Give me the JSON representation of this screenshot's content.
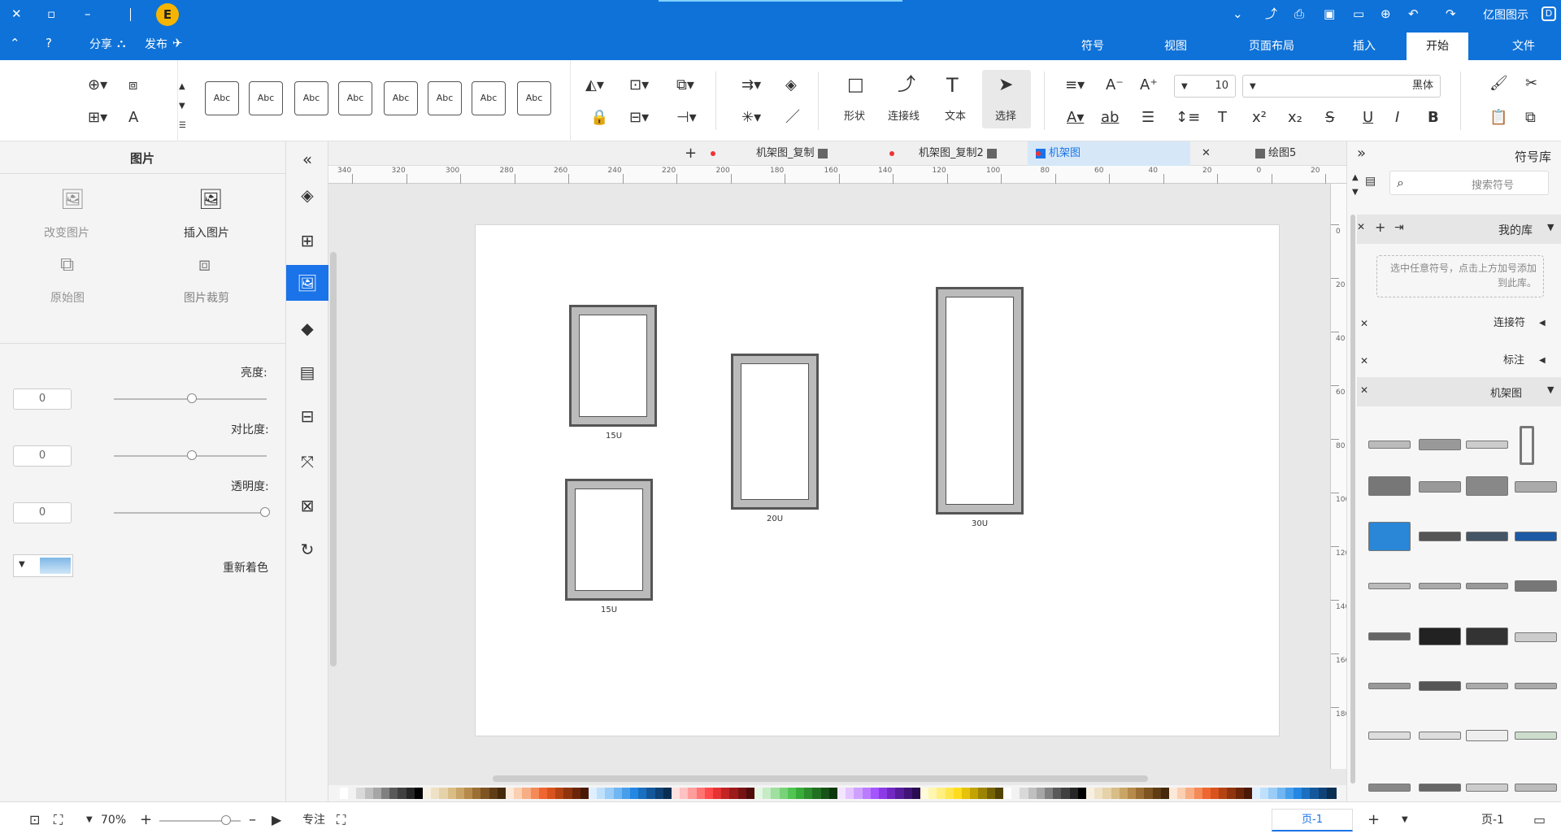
{
  "title_bar": {
    "app_name": "亿图图示",
    "publish_label": "发布",
    "share_label": "分享",
    "tabs": [
      "文件",
      "开始",
      "插入",
      "页面布局",
      "视图",
      "符号"
    ],
    "active_tab": "开始"
  },
  "ribbon": {
    "font_name": "黑体",
    "font_size": "10",
    "select_label": "选择",
    "text_label": "文本",
    "connector_label": "连接线",
    "shape_label": "形状",
    "style_sample": "Abc"
  },
  "doc_tabs": {
    "items": [
      "绘图5",
      "机架图",
      "机架图_复制2",
      "机架图_复制"
    ],
    "active": "机架图"
  },
  "ruler": {
    "h_ticks": [
      "20",
      "0",
      "20",
      "40",
      "60",
      "80",
      "100",
      "120",
      "140",
      "160",
      "180",
      "200",
      "220",
      "240",
      "260",
      "280",
      "300",
      "320",
      "340"
    ],
    "v_ticks": [
      "0",
      "20",
      "40",
      "60",
      "80",
      "100",
      "120",
      "140",
      "160",
      "180"
    ]
  },
  "canvas": {
    "racks": [
      {
        "label": "15U"
      },
      {
        "label": "15U"
      },
      {
        "label": "20U"
      },
      {
        "label": "30U"
      }
    ]
  },
  "left_panel": {
    "title": "图片",
    "insert_image": "插入图片",
    "change_image": "改变图片",
    "crop_image": "图片裁剪",
    "original_image": "原始图",
    "brightness_label": "亮度:",
    "brightness_value": "0",
    "contrast_label": "对比度:",
    "contrast_value": "0",
    "transparency_label": "透明度:",
    "transparency_value": "0",
    "recolor_label": "重新着色"
  },
  "right_panel": {
    "title": "符号库",
    "search_placeholder": "搜索符号",
    "my_library": "我的库",
    "my_library_hint": "选中任意符号，点击上方加号添加到此库。",
    "connectors": "连接符",
    "annotation": "标注",
    "rack_diagram": "机架图"
  },
  "status_bar": {
    "page_name": "页-1",
    "page_tab": "页-1",
    "focus_label": "专注",
    "zoom": "70%"
  },
  "colors": {
    "title_blue": "#0f72d8",
    "accent_blue": "#1a73e8",
    "panel_gray": "#f4f4f4"
  }
}
